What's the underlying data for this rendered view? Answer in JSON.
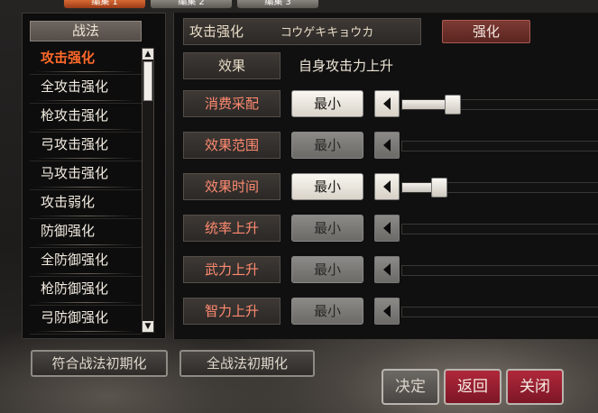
{
  "tabs": [
    "编集 1",
    "编集 2",
    "编集 3"
  ],
  "left": {
    "header": "战法",
    "items": [
      "攻击强化",
      "全攻击强化",
      "枪攻击强化",
      "弓攻击强化",
      "马攻击强化",
      "攻击弱化",
      "防御强化",
      "全防御强化",
      "枪防御强化",
      "弓防御强化"
    ],
    "selected_index": 0
  },
  "right": {
    "name_label": "攻击强化",
    "name_reading": "コウゲキキョウカ",
    "enhance_button": "强化",
    "effect_label": "效果",
    "effect_text": "自身攻击力上升",
    "rows": [
      {
        "label": "消费采配",
        "button": "最小",
        "enabled": true,
        "value": 0.27
      },
      {
        "label": "效果范围",
        "button": "最小",
        "enabled": false,
        "value": 0
      },
      {
        "label": "效果时间",
        "button": "最小",
        "enabled": true,
        "value": 0.2
      },
      {
        "label": "统率上升",
        "button": "最小",
        "enabled": false,
        "value": 0
      },
      {
        "label": "武力上升",
        "button": "最小",
        "enabled": false,
        "value": 0
      },
      {
        "label": "智力上升",
        "button": "最小",
        "enabled": false,
        "value": 0
      }
    ]
  },
  "bottom": {
    "reset_matching": "符合战法初期化",
    "reset_all": "全战法初期化",
    "ok": "决定",
    "back": "返回",
    "close": "关闭"
  }
}
